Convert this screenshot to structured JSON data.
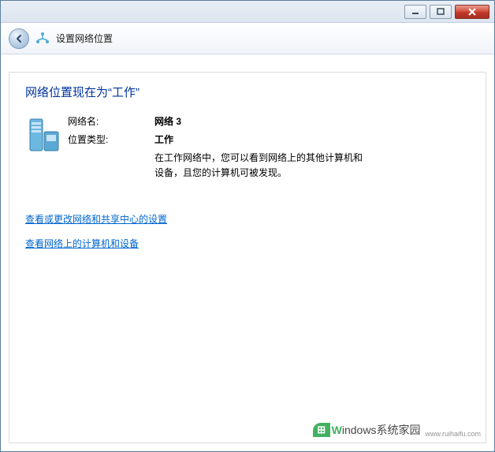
{
  "header": {
    "title": "设置网络位置"
  },
  "main": {
    "title": "网络位置现在为“工作”",
    "fields": {
      "name_label": "网络名:",
      "name_value": "网络 3",
      "type_label": "位置类型:",
      "type_value": "工作",
      "description": "在工作网络中，您可以看到网络上的其他计算机和设备，且您的计算机可被发现。"
    },
    "links": {
      "link1": "查看或更改网络和共享中心的设置",
      "link2": "查看网络上的计算机和设备"
    }
  },
  "watermark": {
    "brand_prefix": "W",
    "brand_rest": "indows系统家园",
    "url": "www.ruihaifu.com"
  }
}
